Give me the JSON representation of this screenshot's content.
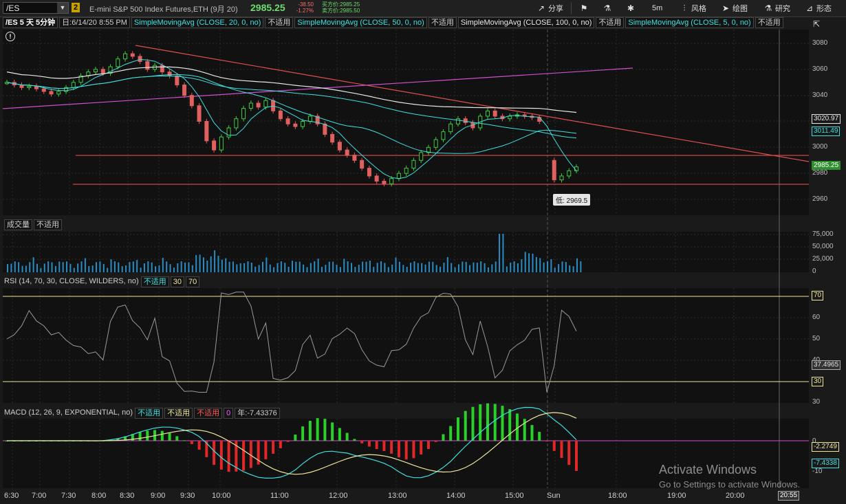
{
  "header": {
    "symbol": "/ES",
    "link_number": "2",
    "description": "E-mini S&P 500 Index Futures,ETH (9月 20)",
    "last_price": "2985.25",
    "net_change": "-38.50",
    "pct_change": "-1.27%",
    "ask_label": "买方价:2985.25",
    "bid_label": "卖方价:2985.50",
    "buttons": {
      "share": "分享",
      "timeframe": "5m",
      "style": "风格",
      "drawing": "绘图",
      "studies": "研究",
      "patterns": "形态"
    }
  },
  "study_bar": {
    "symbol_period": "/ES 5 天 5分钟",
    "date": "日:6/14/20 8:55 PM",
    "studies": [
      {
        "label": "SimpleMovingAvg (CLOSE, 20, 0, no)",
        "color": "#40e0e0",
        "na": "不适用"
      },
      {
        "label": "SimpleMovingAvg (CLOSE, 50, 0, no)",
        "color": "#40e0e0",
        "na": "不适用"
      },
      {
        "label": "SimpleMovingAvg (CLOSE, 100, 0, no)",
        "color": "#e8e8e8",
        "na": "不适用"
      },
      {
        "label": "SimpleMovingAvg (CLOSE, 5, 0, no)",
        "color": "#40e0e0",
        "na": "不适用"
      }
    ]
  },
  "price_panel": {
    "y_ticks": [
      "3080",
      "3060",
      "3040",
      "3020",
      "3000",
      "2980",
      "2960"
    ],
    "tags": [
      {
        "text": "3020.97",
        "color": "#e8e8e8",
        "bg": "#1a1a1a"
      },
      {
        "text": "3011.49",
        "color": "#40e0e0",
        "bg": "#1a1a1a"
      },
      {
        "text": "2985.25",
        "color": "#ffffff",
        "bg": "#2f8f2f"
      }
    ],
    "low_label": "低: 2969.5",
    "alert_icon": "!"
  },
  "volume_panel": {
    "title": "成交量",
    "na": "不适用",
    "y_ticks": [
      "75,000",
      "50,000",
      "25,000",
      "0"
    ]
  },
  "rsi_panel": {
    "title": "RSI (14, 70, 30, CLOSE, WILDERS, no)",
    "na": "不适用",
    "ob": "30",
    "os": "70",
    "y_ticks": [
      "60",
      "50",
      "40",
      "30"
    ],
    "tags": [
      {
        "text": "70"
      },
      {
        "text": "37.4965"
      },
      {
        "text": "30"
      }
    ]
  },
  "macd_panel": {
    "title": "MACD (12, 26, 9, EXPONENTIAL, no)",
    "na1": "不适用",
    "na2": "不适用",
    "na3": "不适用",
    "zero": "0",
    "year": "年:-7.43376",
    "y_ticks": [
      "0",
      "-10"
    ],
    "tags": [
      {
        "text": "-2.2749"
      },
      {
        "text": "-7.4338"
      }
    ]
  },
  "x_axis": [
    "6:30",
    "7:00",
    "7:30",
    "8:00",
    "8:30",
    "9:00",
    "9:30",
    "10:00",
    "11:00",
    "12:00",
    "13:00",
    "14:00",
    "15:00",
    "Sun",
    "18:00",
    "19:00",
    "20:00"
  ],
  "x_cursor": "20:55",
  "watermark": {
    "line1": "Activate Windows",
    "line2": "Go to Settings to activate Windows."
  }
}
